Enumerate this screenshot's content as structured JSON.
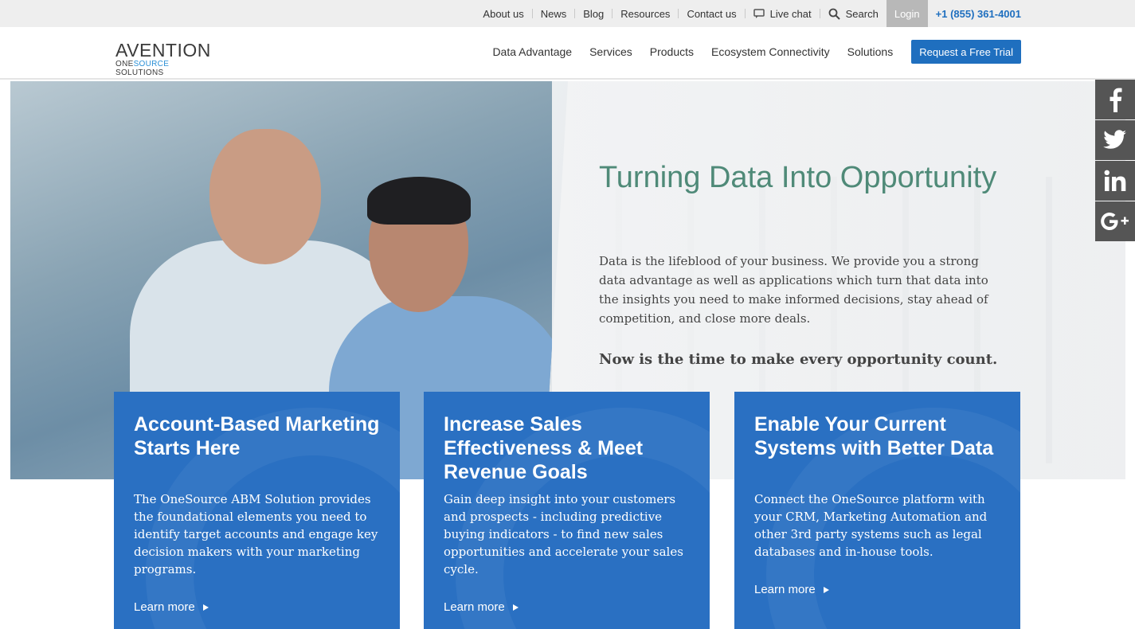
{
  "utility_bar": {
    "links": [
      "About us",
      "News",
      "Blog",
      "Resources",
      "Contact us"
    ],
    "live_chat": "Live chat",
    "search": "Search",
    "login": "Login",
    "phone": "+1 (855) 361-4001"
  },
  "header": {
    "logo_main": "AVENTION",
    "logo_sub_one": "ONE",
    "logo_sub_source": "SOURCE",
    "logo_sub_solutions": " SOLUTIONS",
    "nav": [
      "Data Advantage",
      "Services",
      "Products",
      "Ecosystem Connectivity",
      "Solutions"
    ],
    "cta": "Request a Free Trial"
  },
  "hero": {
    "title": "Turning Data Into Opportunity",
    "description": "Data is the lifeblood of your business. We provide you a strong data advantage as well as applications which turn that data into the insights you need to make informed decisions, stay ahead of competition, and close more deals.",
    "tagline": "Now is the time to make every opportunity count."
  },
  "social": {
    "facebook": "f",
    "twitter": "t",
    "linkedin": "in",
    "googleplus": "G+"
  },
  "cards": [
    {
      "title": "Account-Based Marketing Starts Here",
      "body": "The OneSource ABM Solution provides the foundational elements you need to identify target accounts and engage key decision makers with your marketing programs.",
      "link": "Learn more"
    },
    {
      "title": "Increase Sales Effectiveness & Meet Revenue Goals",
      "body": "Gain deep insight into your customers and prospects - including predictive buying indicators - to find new sales opportunities and accelerate your sales cycle.",
      "link": "Learn more"
    },
    {
      "title": "Enable Your Current Systems with Better Data",
      "body": "Connect the OneSource platform with your CRM, Marketing Automation and other 3rd party systems such as legal databases and in-house tools.",
      "link": "Learn more"
    }
  ],
  "colors": {
    "brand_blue": "#2a70c2",
    "title_green": "#4f8a78",
    "phone_blue": "#1f6fbf"
  }
}
